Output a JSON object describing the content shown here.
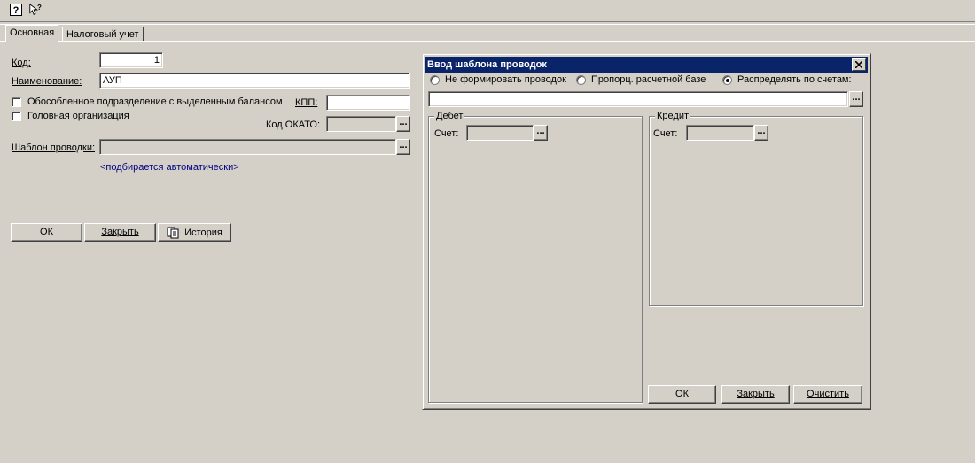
{
  "toolbar": {
    "help_icon": "help-icon",
    "whats_this_icon": "whats-this-pointer-icon"
  },
  "tabs": [
    {
      "label": "Основная"
    },
    {
      "label": "Налоговый учет"
    }
  ],
  "form": {
    "code_label": "Код:",
    "code_value": "1",
    "name_label": "Наименование:",
    "name_value": "АУП",
    "separate_unit_label": "Обособленное подразделение с выделенным балансом",
    "head_org_label": "Головная организация",
    "kpp_label": "КПП:",
    "kpp_value": "",
    "okato_label": "Код ОКАТО:",
    "okato_value": "",
    "template_label": "Шаблон проводки:",
    "template_value": "",
    "template_hint": "<подбирается автоматически>",
    "ok_label": "ОК",
    "close_label": "Закрыть",
    "history_label": "История",
    "browse_label": "..."
  },
  "dialog": {
    "title": "Ввод шаблона проводок",
    "radio_no_entries": "Не формировать проводок",
    "radio_proportional": "Пропорц. расчетной базе",
    "radio_distribute": "Распределять по счетам:",
    "selected_radio": "radio_distribute",
    "accounts_value": "",
    "debit_group": "Дебет",
    "credit_group": "Кредит",
    "account_label": "Счет:",
    "debit_account": "",
    "credit_account": "",
    "ok_label": "ОК",
    "close_label": "Закрыть",
    "clear_label": "Очистить",
    "browse_label": "..."
  }
}
